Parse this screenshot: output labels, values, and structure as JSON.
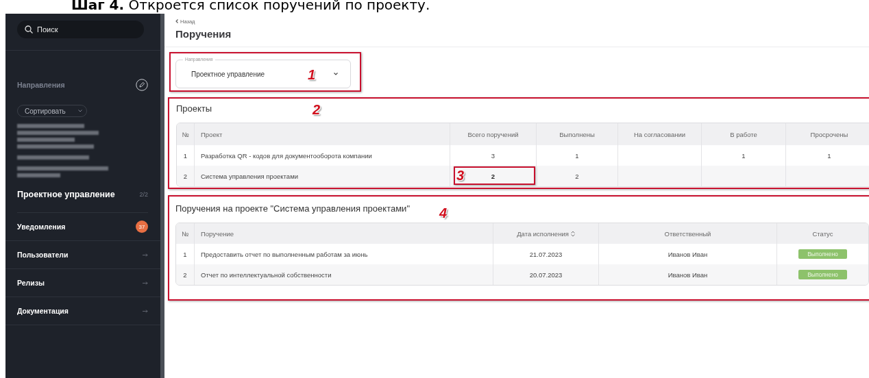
{
  "heading": {
    "step": "Шаг 4.",
    "text": "Откроется список поручений по проекту."
  },
  "sidebar": {
    "search": {
      "placeholder": "Поиск"
    },
    "section_title": "Направления",
    "sort_button": "Сортировать",
    "items": [
      {
        "kind": "redacted"
      },
      {
        "kind": "redacted"
      },
      {
        "kind": "redacted"
      },
      {
        "kind": "direction",
        "label": "Проектное управление",
        "count": "2/2"
      }
    ],
    "nav": [
      {
        "kind": "badge",
        "label": "Уведомления",
        "badge": "37"
      },
      {
        "kind": "link",
        "label": "Пользователи"
      },
      {
        "kind": "link",
        "label": "Релизы"
      },
      {
        "kind": "link",
        "label": "Документация"
      }
    ]
  },
  "page": {
    "back_link": "Назад",
    "title": "Поручения"
  },
  "direction_field": {
    "label": "Направления",
    "value": "Проектное управление",
    "callout": "1"
  },
  "projects": {
    "title": "Проекты",
    "callout": "2",
    "columns": [
      {
        "label": "№"
      },
      {
        "label": "Проект"
      },
      {
        "label": "Всего поручений"
      },
      {
        "label": "Выполнены"
      },
      {
        "label": "На согласовании"
      },
      {
        "label": "В работе"
      },
      {
        "label": "Просрочены"
      }
    ],
    "rows": [
      {
        "cells": [
          "1",
          "Разработка QR - кодов для документооборота компании",
          "3",
          "1",
          null,
          "1",
          "1"
        ]
      },
      {
        "cells": [
          "2",
          "Система управления проектами",
          {
            "text": "2",
            "callout": "3"
          },
          "2",
          null,
          null,
          null
        ]
      }
    ]
  },
  "tasks": {
    "title": "Поручения на проекте \"Система управления проектами\"",
    "callout": "4",
    "columns": [
      {
        "label": "№",
        "sortable": false
      },
      {
        "label": "Поручение",
        "sortable": false
      },
      {
        "label": "Дата исполнения",
        "sortable": true
      },
      {
        "label": "Ответственный",
        "sortable": false
      },
      {
        "label": "Статус",
        "sortable": false
      }
    ],
    "rows": [
      {
        "cells": [
          "1",
          "Предоставить отчет по выполненным работам за июнь",
          "21.07.2023",
          "Иванов Иван"
        ],
        "status": "Выполнено"
      },
      {
        "cells": [
          "2",
          "Отчет по интеллектуальной собственности",
          "20.07.2023",
          "Иванов Иван"
        ],
        "status": "Выполнено"
      }
    ]
  }
}
